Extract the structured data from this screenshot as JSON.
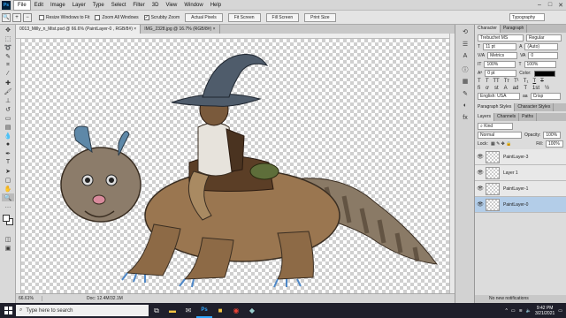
{
  "menu": {
    "logo": "Ps",
    "items": [
      "File",
      "Edit",
      "Image",
      "Layer",
      "Type",
      "Select",
      "Filter",
      "3D",
      "View",
      "Window",
      "Help"
    ],
    "active": "File"
  },
  "options": {
    "resize_windows": "Resize Windows to Fit",
    "zoom_all": "Zoom All Windows",
    "scrubby": "Scrubby Zoom",
    "actual_pixels": "Actual Pixels",
    "fit_screen": "Fit Screen",
    "fill_screen": "Fill Screen",
    "print_size": "Print Size",
    "workspace": "Typography"
  },
  "tabs": [
    {
      "label": "0013_Milly_n_Mist.psd @ 66.6% (PaintLayer-0 , RGB/8#) ×",
      "active": true
    },
    {
      "label": "IMG_2328.jpg @ 16.7% (RGB/8#) ×",
      "active": false
    }
  ],
  "status": {
    "zoom": "66.61%",
    "doc": "Doc: 12.4M/32.1M"
  },
  "character": {
    "tabs": [
      "Character",
      "Paragraph"
    ],
    "font": "Trebuchet MS",
    "style": "Regular",
    "size": "11 pt",
    "leading": "(Auto)",
    "kerning": "Metrics",
    "tracking": "0",
    "vscale": "100%",
    "hscale": "100%",
    "baseline": "0 pt",
    "color_label": "Color:",
    "language": "English: USA",
    "aa": "aa",
    "antialias": "Crisp"
  },
  "styles_tabs": [
    "Paragraph Styles",
    "Character Styles"
  ],
  "layers": {
    "tabs": [
      "Layers",
      "Channels",
      "Paths"
    ],
    "kind": "Kind",
    "blend": "Normal",
    "opacity_label": "Opacity:",
    "opacity": "100%",
    "lock_label": "Lock:",
    "fill_label": "Fill:",
    "fill": "100%",
    "items": [
      {
        "name": "PaintLayer-3",
        "selected": false
      },
      {
        "name": "Layer 1",
        "selected": false
      },
      {
        "name": "PaintLayer-1",
        "selected": false
      },
      {
        "name": "PaintLayer-0",
        "selected": true
      }
    ],
    "no_new_notifications": "No new notifications"
  },
  "taskbar": {
    "search_placeholder": "Type here to search",
    "time": "9:42 PM",
    "date": "3/21/2021"
  }
}
